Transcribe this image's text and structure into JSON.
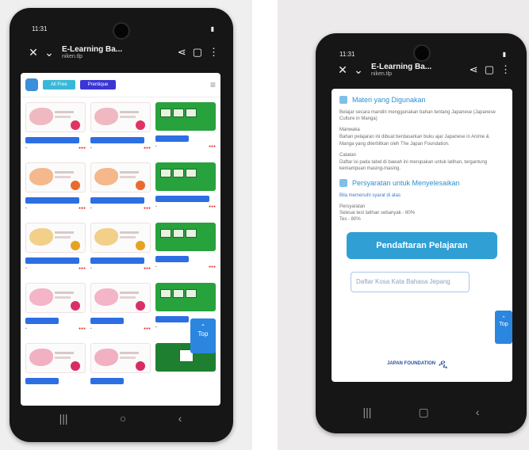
{
  "left_phone": {
    "status_time": "11:31",
    "appbar": {
      "title": "E-Learning Ba...",
      "subtitle": "niken.tlp"
    },
    "header": {
      "tab_a": "All Free",
      "tab_b": "Prentique"
    },
    "fab_label": "Top"
  },
  "right_phone": {
    "status_time": "11:31",
    "appbar": {
      "title": "E-Learning Ba...",
      "subtitle": "niken.tlp"
    },
    "section1_title": "Materi yang Digunakan",
    "section1_text1": "Belajar secara mandiri menggunakan bahan tentang Japanese (Japanese Culture in Manga)",
    "section1_label2": "Manwaka",
    "section1_text2": "Bahan pelajaran ini dibuat berdasarkan buku ajar Japanese in Anime & Manga yang diterbitkan oleh The Japan Foundation.",
    "section1_label3": "Catatan",
    "section1_text3": "Daftar isi pada tabel di bawah ini merupakan untuk latihan, tergantung kemampuan masing-masing.",
    "section2_title": "Persyaratan untuk Menyelesaikan",
    "section2_text1": "Bila memenuhi syarat di atas",
    "section2_label2": "Persyaratan",
    "section2_bullet1": "Selesai test latihan sebanyak - 80%",
    "section2_bullet2": "Tes - 80%",
    "main_button": "Pendaftaran Pelajaran",
    "dictionary_placeholder": "Daftar Kosa Kata Bahasa Jepang",
    "fab_label": "Top",
    "footer_brand": "JAPAN FOUNDATION"
  },
  "colors": {
    "primary_button": "#2f9fd4",
    "link_blue": "#2f8fcf",
    "pill_blue": "#2d6fe3",
    "green_tile": "#27a23c"
  }
}
